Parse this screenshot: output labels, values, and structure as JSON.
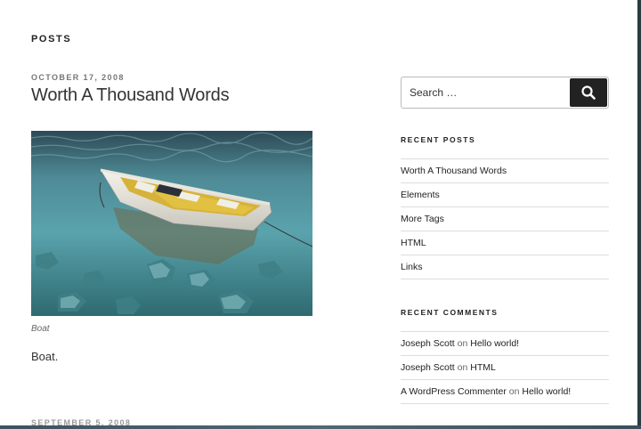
{
  "page": {
    "title": "POSTS"
  },
  "post": {
    "date": "OCTOBER 17, 2008",
    "title": "Worth A Thousand Words",
    "image_alt": "Boat",
    "caption": "Boat",
    "content": "Boat."
  },
  "next_post": {
    "date": "SEPTEMBER 5, 2008"
  },
  "sidebar": {
    "search": {
      "placeholder": "Search …"
    },
    "recent_posts": {
      "title": "RECENT POSTS",
      "items": [
        {
          "label": "Worth A Thousand Words"
        },
        {
          "label": "Elements"
        },
        {
          "label": "More Tags"
        },
        {
          "label": "HTML"
        },
        {
          "label": "Links"
        }
      ]
    },
    "recent_comments": {
      "title": "RECENT COMMENTS",
      "items": [
        {
          "author": "Joseph Scott",
          "on": "on",
          "post": "Hello world!"
        },
        {
          "author": "Joseph Scott",
          "on": "on",
          "post": "HTML"
        },
        {
          "author": "A WordPress Commenter",
          "on": "on",
          "post": "Hello world!"
        }
      ]
    }
  },
  "colors": {
    "text": "#222222",
    "muted": "#767676",
    "button": "#222222",
    "border": "#dddddd"
  },
  "icons": {
    "search": "search-icon"
  }
}
